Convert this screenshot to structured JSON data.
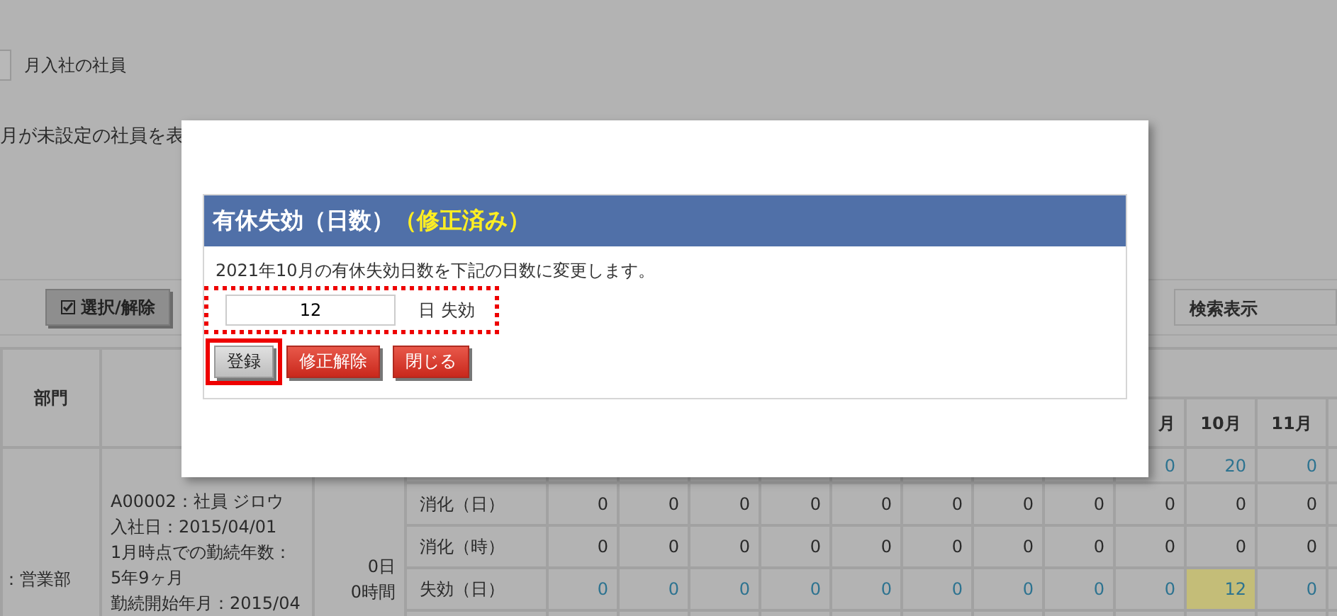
{
  "background_page": {
    "filter_option": {
      "label": "月入社の社員",
      "checked": false
    },
    "note_text": "月が未設定の社員を表",
    "toolbar": {
      "select_button": {
        "label": "選択/解除"
      },
      "display_select": {
        "value": "検索表示"
      }
    },
    "table": {
      "dept_header": "部門",
      "month_headers": [
        "月",
        "10月",
        "11月"
      ],
      "department": "：営業部",
      "employee_lines": [
        "A00002：社員 ジロウ",
        "入社日：2015/04/01",
        "1月時点での勤続年数：",
        "5年9ヶ月",
        "勤続開始年月：2015/04"
      ],
      "balance_lines": [
        "0日",
        "0時間"
      ],
      "rows": [
        {
          "kind": "link",
          "cells": [
            null,
            null,
            null,
            null,
            null,
            null,
            null,
            null,
            {
              "text": "0",
              "highlighted": false
            },
            {
              "text": "20",
              "highlighted": false
            },
            {
              "text": "0",
              "highlighted": false
            }
          ]
        },
        {
          "kind": "plain",
          "label": "消化（日）",
          "cells": [
            {
              "text": "0",
              "highlighted": false
            },
            {
              "text": "0",
              "highlighted": false
            },
            {
              "text": "0",
              "highlighted": false
            },
            {
              "text": "0",
              "highlighted": false
            },
            {
              "text": "0",
              "highlighted": false
            },
            {
              "text": "0",
              "highlighted": false
            },
            {
              "text": "0",
              "highlighted": false
            },
            {
              "text": "0",
              "highlighted": false
            },
            {
              "text": "0",
              "highlighted": false
            },
            {
              "text": "0",
              "highlighted": false
            },
            {
              "text": "0",
              "highlighted": false
            }
          ]
        },
        {
          "kind": "plain",
          "label": "消化（時）",
          "cells": [
            {
              "text": "0",
              "highlighted": false
            },
            {
              "text": "0",
              "highlighted": false
            },
            {
              "text": "0",
              "highlighted": false
            },
            {
              "text": "0",
              "highlighted": false
            },
            {
              "text": "0",
              "highlighted": false
            },
            {
              "text": "0",
              "highlighted": false
            },
            {
              "text": "0",
              "highlighted": false
            },
            {
              "text": "0",
              "highlighted": false
            },
            {
              "text": "0",
              "highlighted": false
            },
            {
              "text": "0",
              "highlighted": false
            },
            {
              "text": "0",
              "highlighted": false
            }
          ]
        },
        {
          "kind": "link",
          "label": "失効（日）",
          "cells": [
            {
              "text": "0",
              "highlighted": false
            },
            {
              "text": "0",
              "highlighted": false
            },
            {
              "text": "0",
              "highlighted": false
            },
            {
              "text": "0",
              "highlighted": false
            },
            {
              "text": "0",
              "highlighted": false
            },
            {
              "text": "0",
              "highlighted": false
            },
            {
              "text": "0",
              "highlighted": false
            },
            {
              "text": "0",
              "highlighted": false
            },
            {
              "text": "0",
              "highlighted": false
            },
            {
              "text": "12",
              "highlighted": true
            },
            {
              "text": "0",
              "highlighted": false
            }
          ]
        }
      ]
    }
  },
  "dialog": {
    "title": "有休失効（日数）",
    "title_status": "（修正済み）",
    "message": "2021年10月の有休失効日数を下記の日数に変更します。",
    "input": {
      "value": "12",
      "unit": "日 失効",
      "annotated": true
    },
    "buttons": [
      {
        "label": "登録",
        "kind": "default",
        "annotated": true
      },
      {
        "label": "修正解除",
        "kind": "danger",
        "annotated": false
      },
      {
        "label": "閉じる",
        "kind": "danger",
        "annotated": false
      }
    ]
  }
}
